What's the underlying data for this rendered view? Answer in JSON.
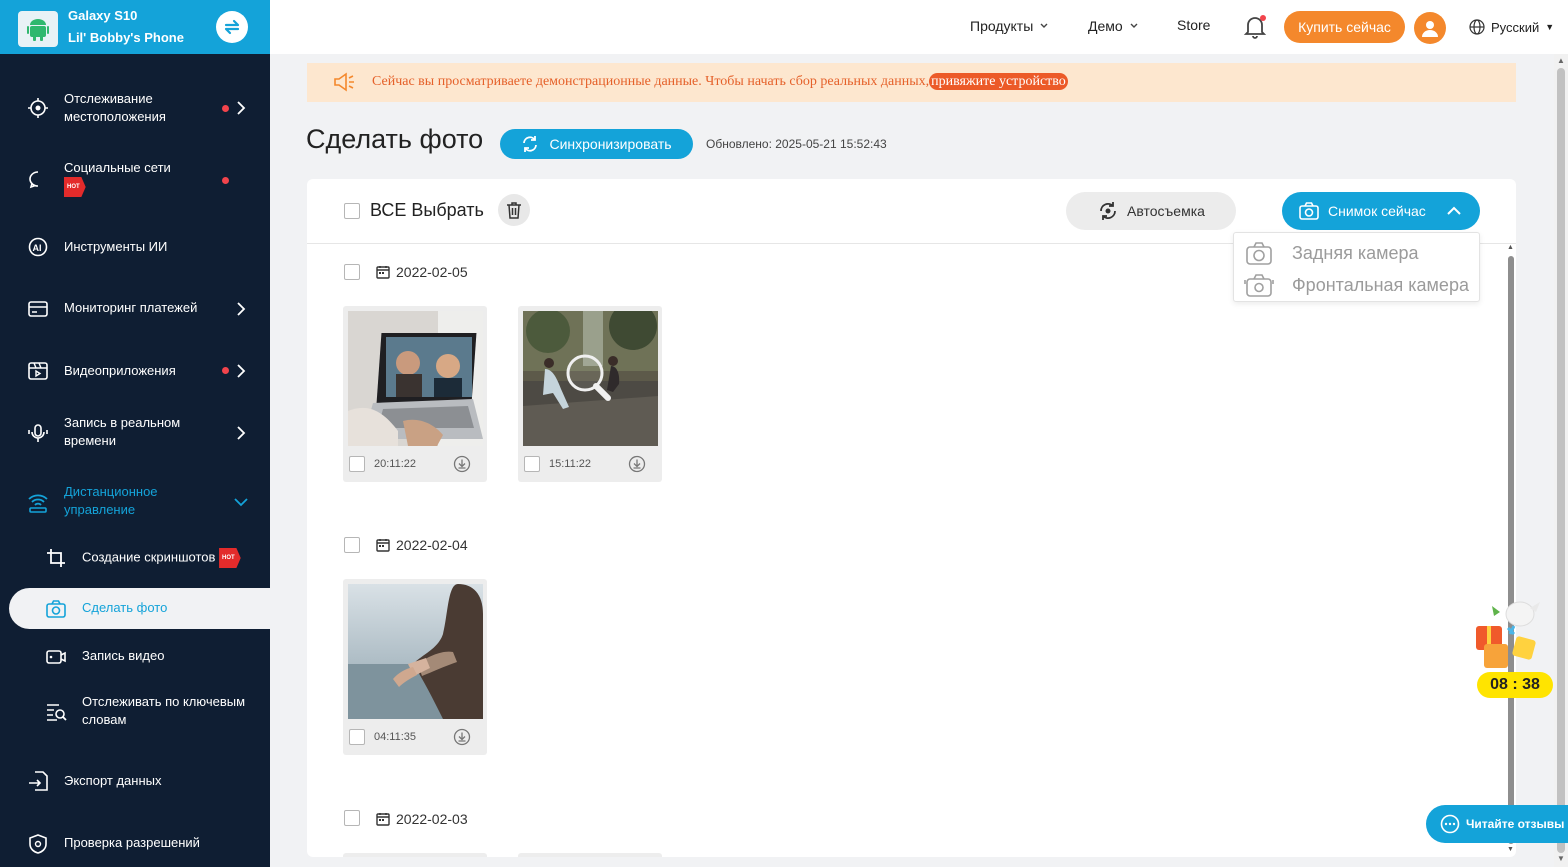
{
  "device": {
    "model": "Galaxy S10",
    "name": "Lil' Bobby's Phone"
  },
  "sidebar": {
    "items": [
      {
        "label": "Отслеживание местоположения"
      },
      {
        "label": "Социальные сети",
        "badge": "HOT"
      },
      {
        "label": "Инструменты ИИ"
      },
      {
        "label": "Мониторинг платежей"
      },
      {
        "label": "Видеоприложения"
      },
      {
        "label": "Запись в реальном времени"
      },
      {
        "label": "Дистанционное управление"
      },
      {
        "label": "Экспорт данных"
      },
      {
        "label": "Проверка разрешений"
      }
    ],
    "sub_items": [
      {
        "label": "Создание скриншотов",
        "badge": "HOT"
      },
      {
        "label": "Сделать фото"
      },
      {
        "label": "Запись видео"
      },
      {
        "label": "Отслеживать по ключевым словам"
      }
    ]
  },
  "topbar": {
    "products": "Продукты",
    "demo": "Демо",
    "store": "Store",
    "buy": "Купить сейчас",
    "language": "Русский"
  },
  "notice": {
    "text": "Сейчас вы просматриваете демонстрационные данные. Чтобы начать сбор реальных данных,",
    "link": "привяжите устройство"
  },
  "page": {
    "title": "Сделать фото",
    "sync": "Синхронизировать",
    "updated": "Обновлено: 2025-05-21 15:52:43"
  },
  "toolbar": {
    "select_all": "ВСЕ Выбрать",
    "auto": "Автосъемка",
    "snap": "Снимок сейчас"
  },
  "dropdown": {
    "rear": "Задняя камера",
    "front": "Фронтальная камера"
  },
  "groups": [
    {
      "date": "2022-02-05",
      "photos": [
        {
          "time": "20:11:22"
        },
        {
          "time": "15:11:22"
        }
      ]
    },
    {
      "date": "2022-02-04",
      "photos": [
        {
          "time": "04:11:35"
        }
      ]
    },
    {
      "date": "2022-02-03",
      "photos": []
    }
  ],
  "widgets": {
    "timer": "08 : 38",
    "reviews": "Читайте отзывы"
  },
  "colors": {
    "accent": "#14a3d9",
    "orange": "#f4882c",
    "sidebar": "#0f1e33",
    "notice_bg": "#fde7cf"
  }
}
